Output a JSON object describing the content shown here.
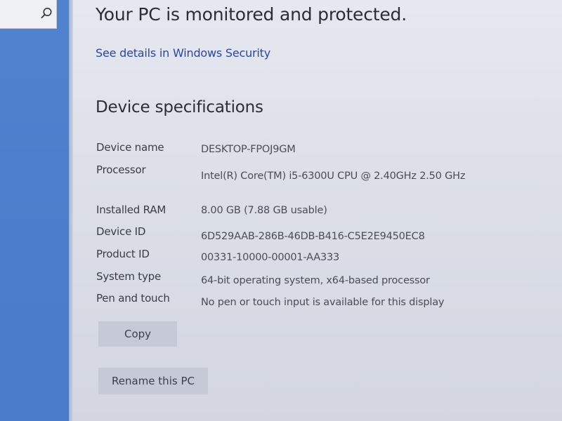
{
  "header": {
    "status_title": "Your PC is monitored and protected.",
    "security_link": "See details in Windows Security"
  },
  "device_specs": {
    "title": "Device specifications",
    "rows": [
      {
        "label": "Device name",
        "value": "DESKTOP-FPOJ9GM"
      },
      {
        "label": "Processor",
        "value": "Intel(R) Core(TM) i5-6300U CPU @ 2.40GHz   2.50 GHz"
      },
      {
        "label": "Installed RAM",
        "value": "8.00 GB (7.88 GB usable)"
      },
      {
        "label": "Device ID",
        "value": "6D529AAB-286B-46DB-B416-C5E2E9450EC8"
      },
      {
        "label": "Product ID",
        "value": "00331-10000-00001-AA333"
      },
      {
        "label": "System type",
        "value": "64-bit operating system, x64-based processor"
      },
      {
        "label": "Pen and touch",
        "value": "No pen or touch input is available for this display"
      }
    ]
  },
  "buttons": {
    "copy": "Copy",
    "rename": "Rename this PC"
  },
  "nav": {
    "search_icon": "search-icon"
  },
  "colors": {
    "nav_pane": "#4d7ecd",
    "link": "#2a45a8",
    "button_bg": "#c6c9d6"
  }
}
